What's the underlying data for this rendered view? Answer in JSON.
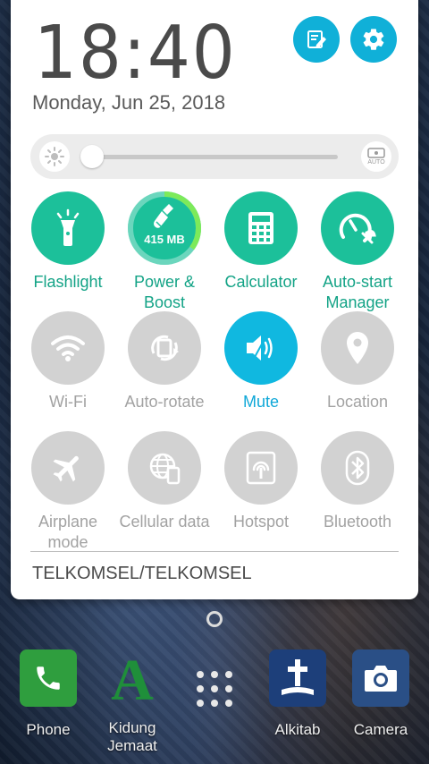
{
  "quick_settings": {
    "clock": "18:40",
    "date": "Monday, Jun 25, 2018",
    "edit_icon": "edit-icon",
    "settings_icon": "gear-icon",
    "brightness": {
      "level": 0.0,
      "auto_label": "AUTO"
    },
    "shortcuts": [
      {
        "label": "Flashlight",
        "icon": "flashlight-icon"
      },
      {
        "label": "Power & Boost",
        "icon": "broom-icon",
        "memory": "415 MB",
        "ring_progress": 0.35
      },
      {
        "label": "Calculator",
        "icon": "calculator-icon"
      },
      {
        "label": "Auto-start Manager",
        "icon": "gauge-wrench-icon"
      }
    ],
    "toggles_row1": [
      {
        "label": "Wi-Fi",
        "icon": "wifi-icon",
        "active": false
      },
      {
        "label": "Auto-rotate",
        "icon": "auto-rotate-icon",
        "active": false
      },
      {
        "label": "Mute",
        "icon": "mute-icon",
        "active": true
      },
      {
        "label": "Location",
        "icon": "location-pin-icon",
        "active": false
      }
    ],
    "toggles_row2": [
      {
        "label": "Airplane mode",
        "icon": "airplane-icon",
        "active": false
      },
      {
        "label": "Cellular data",
        "icon": "cellular-data-icon",
        "active": false
      },
      {
        "label": "Hotspot",
        "icon": "hotspot-icon",
        "active": false
      },
      {
        "label": "Bluetooth",
        "icon": "bluetooth-icon",
        "active": false
      }
    ],
    "carrier": "TELKOMSEL/TELKOMSEL"
  },
  "home": {
    "dock": [
      {
        "label": "Phone",
        "icon": "phone-icon"
      },
      {
        "label": "Kidung Jemaat",
        "icon": "kidung-jemaat-icon"
      },
      {
        "label": "Alkitab",
        "icon": "bible-icon"
      },
      {
        "label": "Camera",
        "icon": "camera-icon"
      }
    ],
    "app_drawer_icon": "app-drawer-icon"
  },
  "colors": {
    "accent_green": "#1cc09a",
    "accent_blue": "#10b8e0",
    "inactive_grey": "#d2d2d2"
  }
}
